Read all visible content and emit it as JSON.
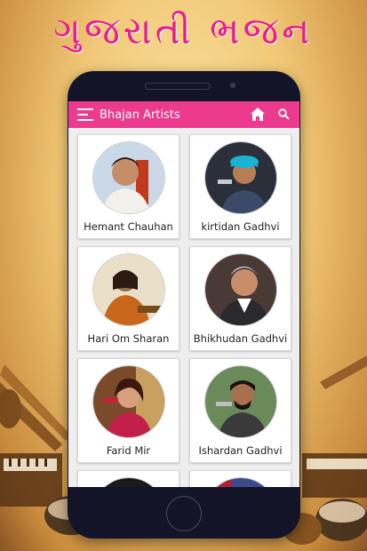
{
  "banner": {
    "title": "ગુજરાતી ભજન"
  },
  "appbar": {
    "title": "Bhajan Artists",
    "menu_icon": "menu-icon",
    "home_icon": "home-icon",
    "search_icon": "search-icon"
  },
  "colors": {
    "accent": "#ec3a8e",
    "banner_text": "#e91e8c",
    "phone_body": "#141428"
  },
  "artists": [
    {
      "name": "Hemant Chauhan"
    },
    {
      "name": "kirtidan Gadhvi"
    },
    {
      "name": "Hari Om Sharan"
    },
    {
      "name": "Bhikhudan Gadhvi"
    },
    {
      "name": "Farid Mir"
    },
    {
      "name": "Ishardan Gadhvi"
    },
    {
      "name": ""
    },
    {
      "name": ""
    }
  ]
}
